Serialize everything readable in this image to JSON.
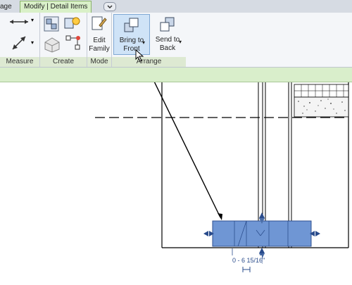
{
  "tabs": {
    "partial": "age",
    "active": "Modify | Detail Items",
    "toggle_icon": "minimize-ribbon-icon"
  },
  "ribbon": {
    "measure": {
      "label": "Measure"
    },
    "create": {
      "label": "Create"
    },
    "mode": {
      "label": "Mode",
      "edit_family_line1": "Edit",
      "edit_family_line2": "Family"
    },
    "arrange": {
      "label": "Arrange",
      "bring_to_front_line1": "Bring to",
      "bring_to_front_line2": "Front",
      "send_to_back_line1": "Send to",
      "send_to_back_line2": "Back"
    }
  },
  "canvas": {
    "dimension_text": "0 - 6 15/16\""
  },
  "colors": {
    "selection": "#5b85c8",
    "ribbon_green": "#d9eecb",
    "highlight": "#cfe3f7"
  }
}
